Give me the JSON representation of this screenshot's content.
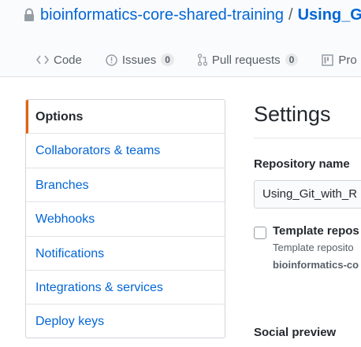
{
  "header": {
    "owner": "bioinformatics-core-shared-training",
    "separator": "/",
    "repo": "Using_G",
    "lock_icon": "lock-icon"
  },
  "tabs": [
    {
      "label": "Code",
      "icon": "code-icon"
    },
    {
      "label": "Issues",
      "icon": "issue-icon",
      "count": "0"
    },
    {
      "label": "Pull requests",
      "icon": "pull-request-icon",
      "count": "0"
    },
    {
      "label": "Pro",
      "icon": "project-icon"
    }
  ],
  "menu": {
    "items": [
      {
        "label": "Options",
        "selected": true
      },
      {
        "label": "Collaborators & teams"
      },
      {
        "label": "Branches"
      },
      {
        "label": "Webhooks"
      },
      {
        "label": "Notifications"
      },
      {
        "label": "Integrations & services"
      },
      {
        "label": "Deploy keys"
      }
    ]
  },
  "settings": {
    "title": "Settings",
    "repo_name_label": "Repository name",
    "repo_name_value": "Using_Git_with_R",
    "template_label": "Template repos",
    "template_note": "Template reposito",
    "template_owner": "bioinformatics-co",
    "social_preview": "Social preview"
  },
  "colors": {
    "link": "#0366d6",
    "selected_accent": "#e36209",
    "border": "#d1d5da"
  }
}
